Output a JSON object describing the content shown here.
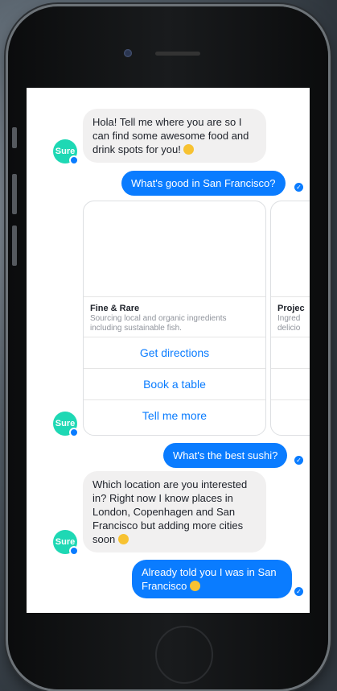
{
  "bot": {
    "avatar_label": "Sure"
  },
  "messages": {
    "m1": "Hola! Tell me where you are so I can find some awesome food and drink spots for you!",
    "m2": "What's good in San Francisco?",
    "m3": "What's the best sushi?",
    "m4": "Which location are you interested in? Right now I know places in London, Copenhagen and San Francisco but adding more cities soon",
    "m5": "Already told you I was in San Francisco"
  },
  "cards": [
    {
      "title": "Fine & Rare",
      "subtitle": "Sourcing local and organic ingredients including sustainable fish.",
      "buttons": [
        "Get directions",
        "Book a table",
        "Tell me more"
      ]
    },
    {
      "title": "Projec",
      "subtitle": "Ingred delicio"
    }
  ],
  "colors": {
    "accent": "#0a7cff",
    "bot_avatar": "#1ed8b4",
    "incoming_bubble": "#f1f0f0"
  }
}
